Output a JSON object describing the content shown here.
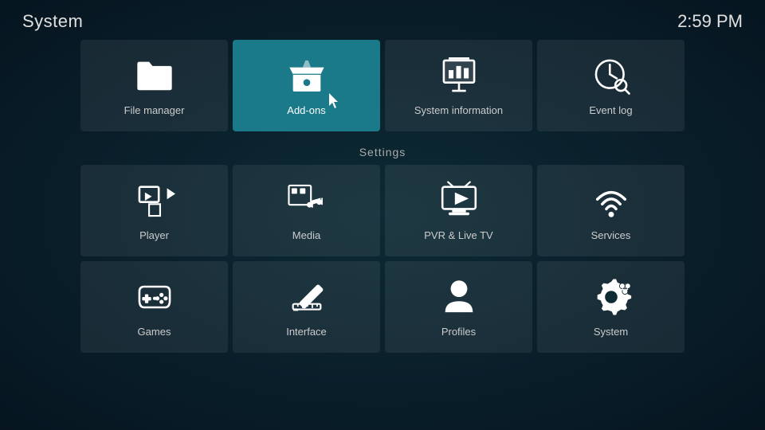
{
  "header": {
    "title": "System",
    "time": "2:59 PM"
  },
  "top_tiles": [
    {
      "id": "file-manager",
      "label": "File manager",
      "icon": "folder",
      "active": false
    },
    {
      "id": "add-ons",
      "label": "Add-ons",
      "icon": "box",
      "active": true
    },
    {
      "id": "system-information",
      "label": "System information",
      "icon": "info-chart",
      "active": false
    },
    {
      "id": "event-log",
      "label": "Event log",
      "icon": "clock-search",
      "active": false
    }
  ],
  "settings": {
    "title": "Settings",
    "tiles": [
      {
        "id": "player",
        "label": "Player",
        "icon": "play"
      },
      {
        "id": "media",
        "label": "Media",
        "icon": "media"
      },
      {
        "id": "pvr-live-tv",
        "label": "PVR & Live TV",
        "icon": "tv"
      },
      {
        "id": "services",
        "label": "Services",
        "icon": "wifi"
      },
      {
        "id": "games",
        "label": "Games",
        "icon": "gamepad"
      },
      {
        "id": "interface",
        "label": "Interface",
        "icon": "pencil"
      },
      {
        "id": "profiles",
        "label": "Profiles",
        "icon": "person"
      },
      {
        "id": "system",
        "label": "System",
        "icon": "gear"
      }
    ]
  }
}
